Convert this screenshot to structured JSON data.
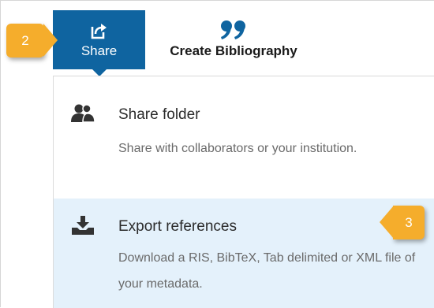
{
  "toolbar": {
    "share": {
      "label": "Share",
      "icon": "share-arrow-icon"
    },
    "bibliography": {
      "label": "Create Bibliography",
      "icon": "quote-icon"
    }
  },
  "menu": {
    "share_folder": {
      "title": "Share folder",
      "description": "Share with collaborators or your institution.",
      "icon": "users-icon"
    },
    "export_references": {
      "title": "Export references",
      "description": "Download a RIS, BibTeX, Tab delimited or XML file of your metadata.",
      "icon": "download-icon"
    }
  },
  "callouts": {
    "step_2": "2",
    "step_3": "3"
  },
  "colors": {
    "share_tab_bg": "#0f64a0",
    "quote_icon": "#0f64a0",
    "highlight_bg": "#e4f1fb",
    "callout_bg": "#f5ad2c"
  }
}
